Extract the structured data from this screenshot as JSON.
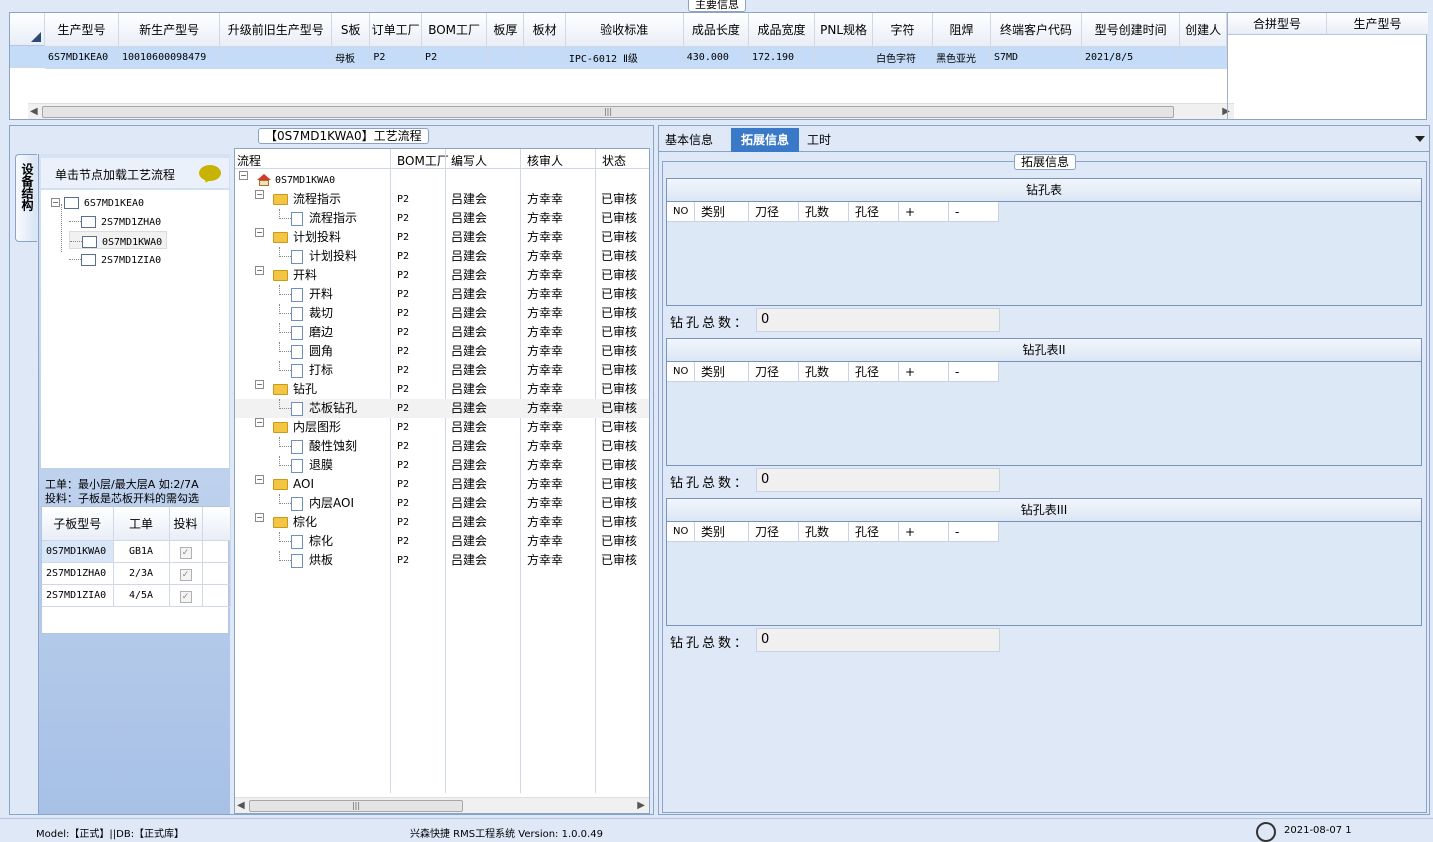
{
  "main_grid": {
    "title": "主要信息",
    "columns": [
      "生产型号",
      "新生产型号",
      "升级前旧生产型号",
      "S板",
      "订单工厂",
      "BOM工厂",
      "板厚",
      "板材",
      "验收标准",
      "成品长度",
      "成品宽度",
      "PNL规格",
      "字符",
      "阻焊",
      "终端客户代码",
      "型号创建时间",
      "创建人"
    ],
    "row": [
      "6S7MD1KEA0",
      "10010600098479",
      "",
      "母板",
      "P2",
      "P2",
      "",
      "",
      "IPC-6012 Ⅱ级",
      "430.000",
      "172.190",
      "",
      "白色字符",
      "黑色亚光",
      "S7MD",
      "2021/8/5",
      ""
    ],
    "right_columns": [
      "合拼型号",
      "生产型号"
    ]
  },
  "process": {
    "title": "【0S7MD1KWA0】工艺流程",
    "vertical_tab": "设备结构",
    "load_hint": "单击节点加载工艺流程",
    "tree": [
      {
        "label": "6S7MD1KEA0",
        "level": 0
      },
      {
        "label": "2S7MD1ZHA0",
        "level": 1
      },
      {
        "label": "0S7MD1KWA0",
        "level": 1
      },
      {
        "label": "2S7MD1ZIA0",
        "level": 1
      }
    ],
    "note1": "工单：最小层/最大层A 如:2/7A",
    "note2": "投料：子板是芯板开料的需勾选",
    "sub_columns": [
      "子板型号",
      "工单",
      "投料"
    ],
    "sub_rows": [
      {
        "model": "0S7MD1KWA0",
        "order": "GB1A"
      },
      {
        "model": "2S7MD1ZHA0",
        "order": "2/3A"
      },
      {
        "model": "2S7MD1ZIA0",
        "order": "4/5A"
      }
    ],
    "flow_columns": [
      "流程",
      "BOM工厂",
      "编写人",
      "核审人",
      "状态"
    ],
    "flow_root": "0S7MD1KWA0",
    "flow_rows": [
      {
        "name": "流程指示",
        "type": "folder",
        "bom": "P2",
        "writer": "吕建会",
        "checker": "方幸幸",
        "status": "已审核"
      },
      {
        "name": "流程指示",
        "type": "doc",
        "bom": "P2",
        "writer": "吕建会",
        "checker": "方幸幸",
        "status": "已审核"
      },
      {
        "name": "计划投料",
        "type": "folder",
        "bom": "P2",
        "writer": "吕建会",
        "checker": "方幸幸",
        "status": "已审核"
      },
      {
        "name": "计划投料",
        "type": "doc",
        "bom": "P2",
        "writer": "吕建会",
        "checker": "方幸幸",
        "status": "已审核"
      },
      {
        "name": "开料",
        "type": "folder",
        "bom": "P2",
        "writer": "吕建会",
        "checker": "方幸幸",
        "status": "已审核"
      },
      {
        "name": "开料",
        "type": "doc",
        "bom": "P2",
        "writer": "吕建会",
        "checker": "方幸幸",
        "status": "已审核"
      },
      {
        "name": "裁切",
        "type": "doc",
        "bom": "P2",
        "writer": "吕建会",
        "checker": "方幸幸",
        "status": "已审核"
      },
      {
        "name": "磨边",
        "type": "doc",
        "bom": "P2",
        "writer": "吕建会",
        "checker": "方幸幸",
        "status": "已审核"
      },
      {
        "name": "圆角",
        "type": "doc",
        "bom": "P2",
        "writer": "吕建会",
        "checker": "方幸幸",
        "status": "已审核"
      },
      {
        "name": "打标",
        "type": "doc",
        "bom": "P2",
        "writer": "吕建会",
        "checker": "方幸幸",
        "status": "已审核"
      },
      {
        "name": "钻孔",
        "type": "folder",
        "bom": "P2",
        "writer": "吕建会",
        "checker": "方幸幸",
        "status": "已审核"
      },
      {
        "name": "芯板钻孔",
        "type": "doc",
        "bom": "P2",
        "writer": "吕建会",
        "checker": "方幸幸",
        "status": "已审核"
      },
      {
        "name": "内层图形",
        "type": "folder",
        "bom": "P2",
        "writer": "吕建会",
        "checker": "方幸幸",
        "status": "已审核"
      },
      {
        "name": "酸性蚀刻",
        "type": "doc",
        "bom": "P2",
        "writer": "吕建会",
        "checker": "方幸幸",
        "status": "已审核"
      },
      {
        "name": "退膜",
        "type": "doc",
        "bom": "P2",
        "writer": "吕建会",
        "checker": "方幸幸",
        "status": "已审核"
      },
      {
        "name": "AOI",
        "type": "folder",
        "bom": "P2",
        "writer": "吕建会",
        "checker": "方幸幸",
        "status": "已审核"
      },
      {
        "name": "内层AOI",
        "type": "doc",
        "bom": "P2",
        "writer": "吕建会",
        "checker": "方幸幸",
        "status": "已审核"
      },
      {
        "name": "棕化",
        "type": "folder",
        "bom": "P2",
        "writer": "吕建会",
        "checker": "方幸幸",
        "status": "已审核"
      },
      {
        "name": "棕化",
        "type": "doc",
        "bom": "P2",
        "writer": "吕建会",
        "checker": "方幸幸",
        "status": "已审核"
      },
      {
        "name": "烘板",
        "type": "doc",
        "bom": "P2",
        "writer": "吕建会",
        "checker": "方幸幸",
        "status": "已审核"
      }
    ]
  },
  "right": {
    "tabs": [
      "基本信息",
      "拓展信息",
      "工时"
    ],
    "group_title": "拓展信息",
    "drill_columns": [
      "NO",
      "类别",
      "刀径",
      "孔数",
      "孔径",
      "+",
      "-"
    ],
    "tables": [
      {
        "title": "钻孔表",
        "total_label": "钻孔总数：",
        "total": "0"
      },
      {
        "title": "钻孔表II",
        "total_label": "钻孔总数：",
        "total": "0"
      },
      {
        "title": "钻孔表III",
        "total_label": "钻孔总数：",
        "total": "0"
      }
    ]
  },
  "status_bar": {
    "left": "Model:【正式】||DB:【正式库】",
    "center": "兴森快捷 RMS工程系统 Version: 1.0.0.49",
    "right": "2021-08-07 1"
  }
}
